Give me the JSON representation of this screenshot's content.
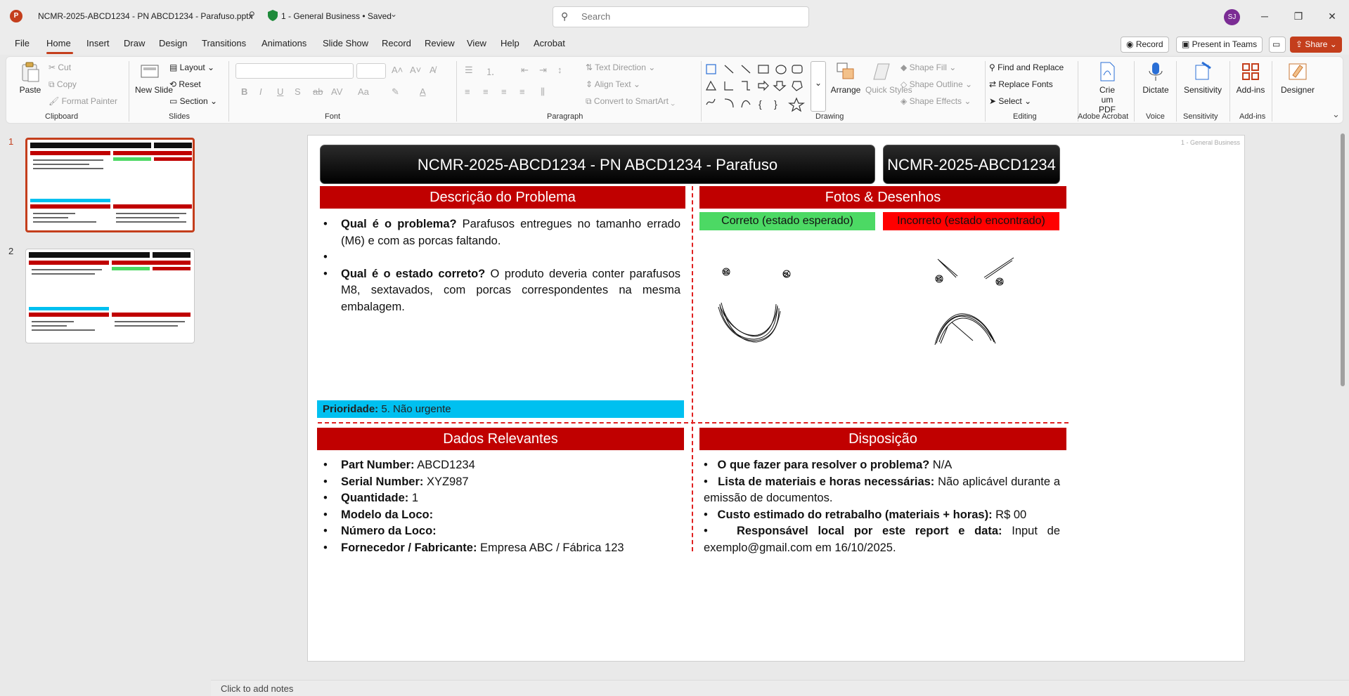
{
  "titlebar": {
    "filename": "NCMR-2025-ABCD1234 - PN ABCD1234 - Parafuso.pptx",
    "sensitivity_status": "1 - General Business • Saved",
    "search_placeholder": "Search",
    "avatar_initials": "SJ"
  },
  "menu": {
    "tabs": [
      "File",
      "Home",
      "Insert",
      "Draw",
      "Design",
      "Transitions",
      "Animations",
      "Slide Show",
      "Record",
      "Review",
      "View",
      "Help",
      "Acrobat"
    ],
    "record_btn": "Record",
    "present_btn": "Present in Teams",
    "share_btn": "Share"
  },
  "ribbon": {
    "clipboard": {
      "paste": "Paste",
      "cut": "Cut",
      "copy": "Copy",
      "format_painter": "Format Painter",
      "label": "Clipboard"
    },
    "slides": {
      "new_slide": "New Slide",
      "layout": "Layout",
      "reset": "Reset",
      "section": "Section",
      "label": "Slides"
    },
    "font": {
      "label": "Font"
    },
    "paragraph": {
      "text_direction": "Text Direction",
      "align_text": "Align Text",
      "convert_smartart": "Convert to SmartArt",
      "label": "Paragraph"
    },
    "drawing": {
      "arrange": "Arrange",
      "quick_styles": "Quick Styles",
      "shape_fill": "Shape Fill",
      "shape_outline": "Shape Outline",
      "shape_effects": "Shape Effects",
      "label": "Drawing"
    },
    "editing": {
      "find_replace": "Find and Replace",
      "replace_fonts": "Replace Fonts",
      "select": "Select",
      "label": "Editing"
    },
    "adobe": {
      "create_pdf": "Crie um PDF",
      "label": "Adobe Acrobat"
    },
    "voice": {
      "dictate": "Dictate",
      "label": "Voice"
    },
    "sensitivity": {
      "btn": "Sensitivity",
      "label": "Sensitivity"
    },
    "addins": {
      "btn": "Add-ins",
      "label": "Add-ins"
    },
    "designer": {
      "btn": "Designer"
    }
  },
  "thumbnails": {
    "numbers": [
      "1",
      "2"
    ]
  },
  "slide": {
    "corner_label": "1 - General Business",
    "title_main": "NCMR-2025-ABCD1234 - PN ABCD1234 - Parafuso",
    "title_id": "NCMR-2025-ABCD1234",
    "problem": {
      "header": "Descrição do Problema",
      "q1_label": "Qual é o problema?",
      "q1_text": " Parafusos entregues no tamanho errado (M6) e com as porcas faltando.",
      "q2_label": "Qual é o estado correto?",
      "q2_text": " O produto deveria conter parafusos M8, sextavados, com porcas correspondentes na mesma embalagem.",
      "priority_label": "Prioridade:",
      "priority_value": " 5. Não urgente"
    },
    "photos": {
      "header": "Fotos & Desenhos",
      "correct": "Correto (estado esperado)",
      "incorrect": "Incorreto (estado encontrado)"
    },
    "data": {
      "header": "Dados Relevantes",
      "rows": [
        {
          "label": "Part Number:",
          "value": " ABCD1234"
        },
        {
          "label": "Serial Number:",
          "value": " XYZ987"
        },
        {
          "label": "Quantidade:",
          "value": " 1"
        },
        {
          "label": "Modelo da Loco:",
          "value": ""
        },
        {
          "label": "Número da Loco:",
          "value": ""
        },
        {
          "label": "Fornecedor / Fabricante:",
          "value": " Empresa ABC / Fábrica 123"
        }
      ]
    },
    "disposition": {
      "header": "Disposição",
      "d1_label": "O que fazer para resolver o problema?",
      "d1_text": " N/A",
      "d2_label": "Lista de materiais e horas necessárias:",
      "d2_text": " Não aplicável durante a emissão de documentos.",
      "d3_label": "Custo estimado do retrabalho (materiais + horas):",
      "d3_text": " R$ 00",
      "d4_label": "Responsável local por este report e data:",
      "d4_text": " Input de exemplo@gmail.com em 16/10/2025."
    }
  },
  "notes": {
    "placeholder": "Click to add notes"
  }
}
